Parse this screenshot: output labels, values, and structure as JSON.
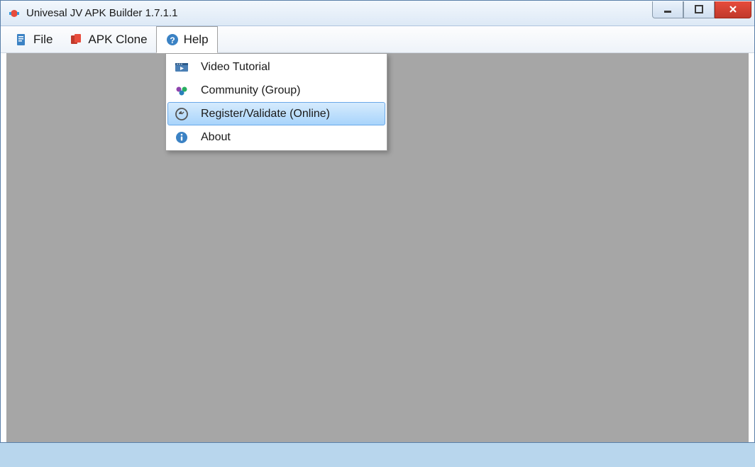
{
  "title": "Univesal JV APK Builder 1.7.1.1",
  "menubar": {
    "file": {
      "label": "File"
    },
    "apk_clone": {
      "label": "APK Clone"
    },
    "help": {
      "label": "Help"
    }
  },
  "help_menu": {
    "video_tutorial": {
      "label": "Video Tutorial"
    },
    "community": {
      "label": "Community (Group)"
    },
    "register": {
      "label": "Register/Validate (Online)"
    },
    "about": {
      "label": "About"
    }
  }
}
